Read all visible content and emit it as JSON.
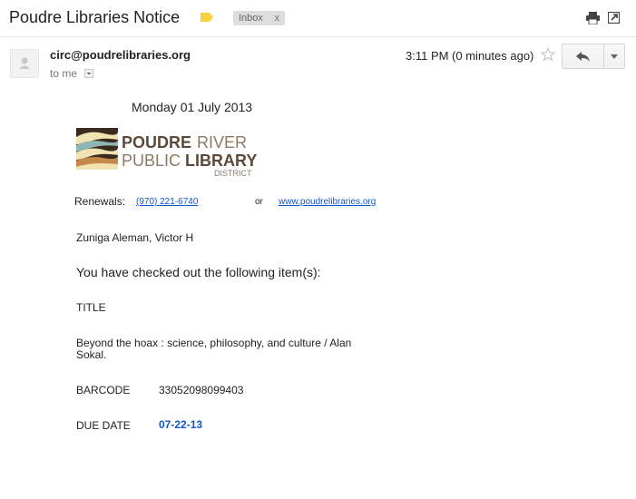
{
  "header": {
    "subject": "Poudre Libraries Notice",
    "label_chip": "Inbox",
    "label_chip_remove": "x",
    "label_color": "#f7d23e"
  },
  "message": {
    "sender": "circ@poudrelibraries.org",
    "recipient": "to me",
    "timestamp": "3:11 PM (0 minutes ago)"
  },
  "notice": {
    "date": "Monday 01 July 2013",
    "logo": {
      "line1_bold": "POUDRE",
      "line1_light": "RIVER",
      "line2_light": "PUBLIC",
      "line2_bold": "LIBRARY",
      "line3": "DISTRICT"
    },
    "renewals_label": "Renewals:",
    "renewals_phone": "(970) 221-6740",
    "renewals_or": "or",
    "renewals_url": "www.poudrelibraries.org",
    "patron": "Zuniga Aleman, Victor H",
    "checkout_heading": "You have checked out the following item(s):",
    "title_label": "TITLE",
    "item_title": "Beyond the hoax : science, philosophy, and culture / Alan Sokal.",
    "barcode_label": "BARCODE",
    "barcode": "33052098099403",
    "due_label": "DUE DATE",
    "due_date": "07-22-13"
  },
  "colors": {
    "link": "#1155cc",
    "logo_brown": "#5b4a3a",
    "logo_light": "#8a7a62"
  },
  "icons": [
    "label-tag-icon",
    "print-icon",
    "new-window-icon",
    "avatar-icon",
    "dropdown-arrow-icon",
    "star-icon",
    "reply-icon",
    "chevron-down-icon"
  ]
}
